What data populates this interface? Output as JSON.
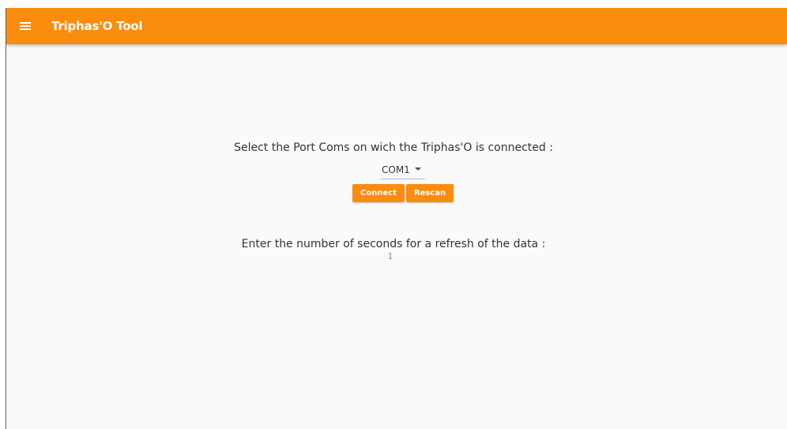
{
  "app": {
    "title": "Triphas'O Tool",
    "accent_color": "#fb8c0e",
    "menu_icon": "hamburger-menu-icon"
  },
  "port": {
    "prompt": "Select the Port Coms on wich the Triphas'O is connected :",
    "selected": "COM1",
    "connect_label": "Connect",
    "rescan_label": "Rescan"
  },
  "refresh": {
    "prompt": "Enter the number of seconds for a refresh of the data :",
    "value": "1"
  }
}
